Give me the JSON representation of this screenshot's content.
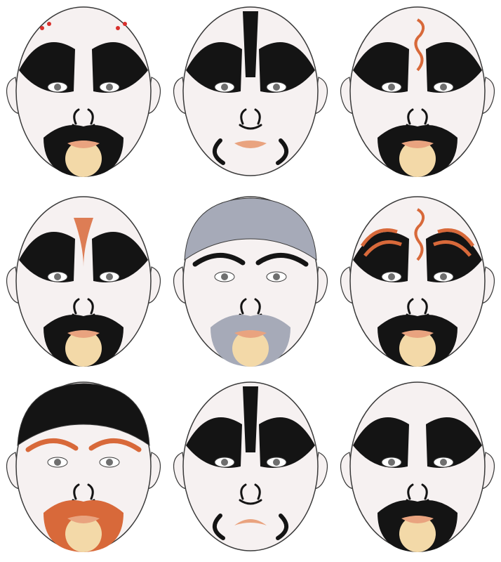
{
  "palette": {
    "black": "#141414",
    "skin": "#f6f1f1",
    "outline": "#3a3a3a",
    "orange": "#d8693a",
    "red": "#d9302c",
    "grey": "#a6aab8",
    "lip": "#e9a37f",
    "chin": "#f3d9a8",
    "pink": "#f1d7d7"
  },
  "masks": [
    {
      "id": "mask-1",
      "style": "black-brows-red-dots",
      "beard": "black",
      "cap": "none",
      "accent": "red"
    },
    {
      "id": "mask-2",
      "style": "black-white-symmetric",
      "beard": "none",
      "cap": "none",
      "accent": "grey"
    },
    {
      "id": "mask-3",
      "style": "black-swirl-orange-forehead",
      "beard": "black",
      "cap": "none",
      "accent": "orange"
    },
    {
      "id": "mask-4",
      "style": "black-brows-orange-forehead",
      "beard": "black",
      "cap": "none",
      "accent": "orange"
    },
    {
      "id": "mask-5",
      "style": "grey-cap-grey-beard",
      "beard": "grey",
      "cap": "grey",
      "accent": "grey"
    },
    {
      "id": "mask-6",
      "style": "orange-flame-swirl",
      "beard": "black",
      "cap": "none",
      "accent": "orange"
    },
    {
      "id": "mask-7",
      "style": "black-cap-orange-beard",
      "beard": "orange",
      "cap": "black",
      "accent": "orange"
    },
    {
      "id": "mask-8",
      "style": "black-white-frown",
      "beard": "none",
      "cap": "none",
      "accent": "orange"
    },
    {
      "id": "mask-9",
      "style": "black-brows-white-forehead",
      "beard": "black",
      "cap": "none",
      "accent": "red"
    }
  ]
}
